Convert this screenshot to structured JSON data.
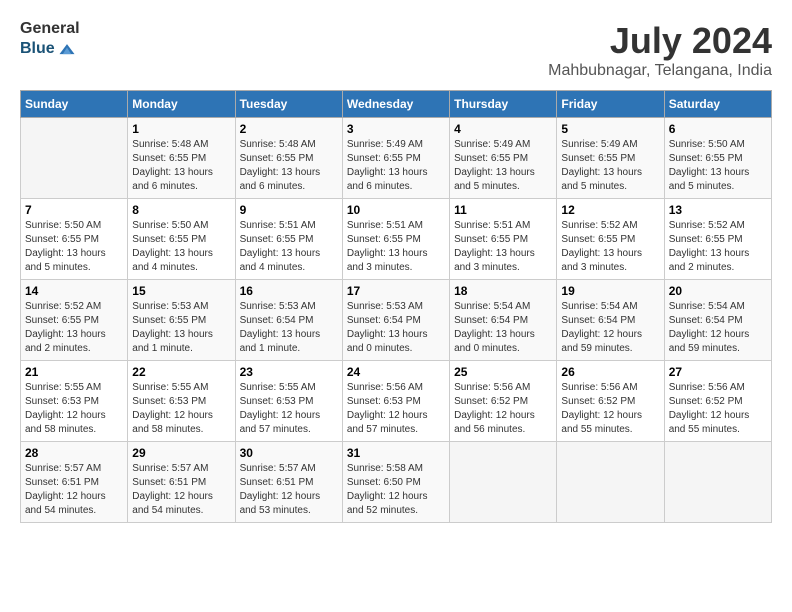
{
  "logo": {
    "general": "General",
    "blue": "Blue"
  },
  "title": "July 2024",
  "subtitle": "Mahbubnagar, Telangana, India",
  "days_of_week": [
    "Sunday",
    "Monday",
    "Tuesday",
    "Wednesday",
    "Thursday",
    "Friday",
    "Saturday"
  ],
  "weeks": [
    [
      {
        "day": "",
        "info": ""
      },
      {
        "day": "1",
        "info": "Sunrise: 5:48 AM\nSunset: 6:55 PM\nDaylight: 13 hours\nand 6 minutes."
      },
      {
        "day": "2",
        "info": "Sunrise: 5:48 AM\nSunset: 6:55 PM\nDaylight: 13 hours\nand 6 minutes."
      },
      {
        "day": "3",
        "info": "Sunrise: 5:49 AM\nSunset: 6:55 PM\nDaylight: 13 hours\nand 6 minutes."
      },
      {
        "day": "4",
        "info": "Sunrise: 5:49 AM\nSunset: 6:55 PM\nDaylight: 13 hours\nand 5 minutes."
      },
      {
        "day": "5",
        "info": "Sunrise: 5:49 AM\nSunset: 6:55 PM\nDaylight: 13 hours\nand 5 minutes."
      },
      {
        "day": "6",
        "info": "Sunrise: 5:50 AM\nSunset: 6:55 PM\nDaylight: 13 hours\nand 5 minutes."
      }
    ],
    [
      {
        "day": "7",
        "info": "Sunrise: 5:50 AM\nSunset: 6:55 PM\nDaylight: 13 hours\nand 5 minutes."
      },
      {
        "day": "8",
        "info": "Sunrise: 5:50 AM\nSunset: 6:55 PM\nDaylight: 13 hours\nand 4 minutes."
      },
      {
        "day": "9",
        "info": "Sunrise: 5:51 AM\nSunset: 6:55 PM\nDaylight: 13 hours\nand 4 minutes."
      },
      {
        "day": "10",
        "info": "Sunrise: 5:51 AM\nSunset: 6:55 PM\nDaylight: 13 hours\nand 3 minutes."
      },
      {
        "day": "11",
        "info": "Sunrise: 5:51 AM\nSunset: 6:55 PM\nDaylight: 13 hours\nand 3 minutes."
      },
      {
        "day": "12",
        "info": "Sunrise: 5:52 AM\nSunset: 6:55 PM\nDaylight: 13 hours\nand 3 minutes."
      },
      {
        "day": "13",
        "info": "Sunrise: 5:52 AM\nSunset: 6:55 PM\nDaylight: 13 hours\nand 2 minutes."
      }
    ],
    [
      {
        "day": "14",
        "info": "Sunrise: 5:52 AM\nSunset: 6:55 PM\nDaylight: 13 hours\nand 2 minutes."
      },
      {
        "day": "15",
        "info": "Sunrise: 5:53 AM\nSunset: 6:55 PM\nDaylight: 13 hours\nand 1 minute."
      },
      {
        "day": "16",
        "info": "Sunrise: 5:53 AM\nSunset: 6:54 PM\nDaylight: 13 hours\nand 1 minute."
      },
      {
        "day": "17",
        "info": "Sunrise: 5:53 AM\nSunset: 6:54 PM\nDaylight: 13 hours\nand 0 minutes."
      },
      {
        "day": "18",
        "info": "Sunrise: 5:54 AM\nSunset: 6:54 PM\nDaylight: 13 hours\nand 0 minutes."
      },
      {
        "day": "19",
        "info": "Sunrise: 5:54 AM\nSunset: 6:54 PM\nDaylight: 12 hours\nand 59 minutes."
      },
      {
        "day": "20",
        "info": "Sunrise: 5:54 AM\nSunset: 6:54 PM\nDaylight: 12 hours\nand 59 minutes."
      }
    ],
    [
      {
        "day": "21",
        "info": "Sunrise: 5:55 AM\nSunset: 6:53 PM\nDaylight: 12 hours\nand 58 minutes."
      },
      {
        "day": "22",
        "info": "Sunrise: 5:55 AM\nSunset: 6:53 PM\nDaylight: 12 hours\nand 58 minutes."
      },
      {
        "day": "23",
        "info": "Sunrise: 5:55 AM\nSunset: 6:53 PM\nDaylight: 12 hours\nand 57 minutes."
      },
      {
        "day": "24",
        "info": "Sunrise: 5:56 AM\nSunset: 6:53 PM\nDaylight: 12 hours\nand 57 minutes."
      },
      {
        "day": "25",
        "info": "Sunrise: 5:56 AM\nSunset: 6:52 PM\nDaylight: 12 hours\nand 56 minutes."
      },
      {
        "day": "26",
        "info": "Sunrise: 5:56 AM\nSunset: 6:52 PM\nDaylight: 12 hours\nand 55 minutes."
      },
      {
        "day": "27",
        "info": "Sunrise: 5:56 AM\nSunset: 6:52 PM\nDaylight: 12 hours\nand 55 minutes."
      }
    ],
    [
      {
        "day": "28",
        "info": "Sunrise: 5:57 AM\nSunset: 6:51 PM\nDaylight: 12 hours\nand 54 minutes."
      },
      {
        "day": "29",
        "info": "Sunrise: 5:57 AM\nSunset: 6:51 PM\nDaylight: 12 hours\nand 54 minutes."
      },
      {
        "day": "30",
        "info": "Sunrise: 5:57 AM\nSunset: 6:51 PM\nDaylight: 12 hours\nand 53 minutes."
      },
      {
        "day": "31",
        "info": "Sunrise: 5:58 AM\nSunset: 6:50 PM\nDaylight: 12 hours\nand 52 minutes."
      },
      {
        "day": "",
        "info": ""
      },
      {
        "day": "",
        "info": ""
      },
      {
        "day": "",
        "info": ""
      }
    ]
  ]
}
